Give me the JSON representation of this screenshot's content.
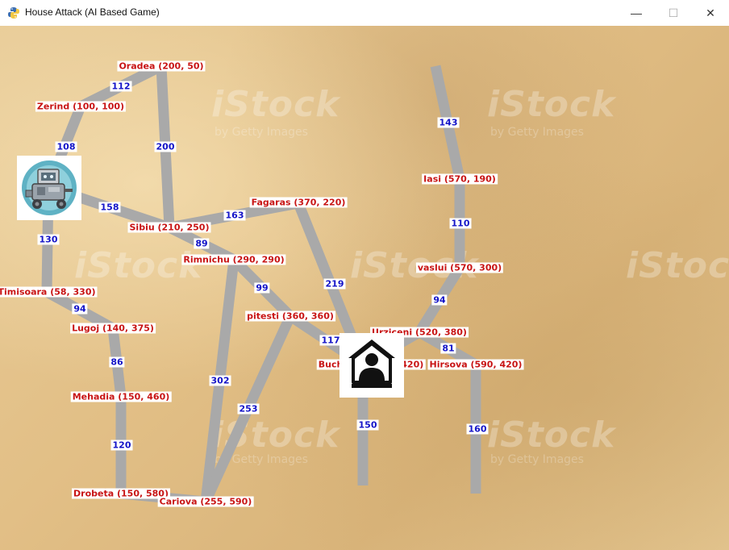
{
  "window": {
    "title": "House Attack (AI Based Game)",
    "minimize_glyph": "—",
    "maximize_glyph": "☐",
    "close_glyph": "✕",
    "app_icon": "python-snake-icon"
  },
  "watermark": {
    "brand": "iStock",
    "sub": "by Getty Images"
  },
  "colors": {
    "road": "#a9a9a9",
    "city_text": "#c81414",
    "distance_text": "#1414c8",
    "sand": "#e2bf86"
  },
  "cities": [
    {
      "id": "oradea",
      "label": "Oradea (200, 50)"
    },
    {
      "id": "zerind",
      "label": "Zerind (100, 100)"
    },
    {
      "id": "sibiu",
      "label": "Sibiu (210, 250)"
    },
    {
      "id": "fagaras",
      "label": "Fagaras (370, 220)"
    },
    {
      "id": "rimnichu",
      "label": "Rimnichu (290, 290)"
    },
    {
      "id": "timisoara",
      "label": "Timisoara (58, 330)"
    },
    {
      "id": "lugoj",
      "label": "Lugoj (140, 375)"
    },
    {
      "id": "pitesti",
      "label": "pitesti (360, 360)"
    },
    {
      "id": "mehadia",
      "label": "Mehadia (150, 460)"
    },
    {
      "id": "drobeta",
      "label": "Drobeta (150, 580)"
    },
    {
      "id": "cariova",
      "label": "Cariova (255, 590)"
    },
    {
      "id": "iasi",
      "label": "Iasi (570, 190)"
    },
    {
      "id": "vaslui",
      "label": "vaslui (570, 300)"
    },
    {
      "id": "urziceni",
      "label": "Urziceni (520, 380)"
    },
    {
      "id": "bucharest",
      "label": "Bucharest (450, 420)"
    },
    {
      "id": "hirsova",
      "label": "Hirsova (590, 420)"
    }
  ],
  "distances": [
    {
      "id": "oradea-zerind",
      "value": "112"
    },
    {
      "id": "oradea-sibiu",
      "value": "200"
    },
    {
      "id": "zerind-arad",
      "value": "108"
    },
    {
      "id": "arad-sibiu",
      "value": "158"
    },
    {
      "id": "arad-timisoara",
      "value": "130"
    },
    {
      "id": "sibiu-fagaras",
      "value": "163"
    },
    {
      "id": "sibiu-rimnichu",
      "value": "89"
    },
    {
      "id": "fagaras-bucharest",
      "value": "219"
    },
    {
      "id": "rimnichu-pitesti",
      "value": "99"
    },
    {
      "id": "rimnichu-cariova",
      "value": "302"
    },
    {
      "id": "pitesti-cariova",
      "value": "253"
    },
    {
      "id": "pitesti-bucharest",
      "value": "117"
    },
    {
      "id": "timisoara-lugoj",
      "value": "94"
    },
    {
      "id": "lugoj-mehadia",
      "value": "86"
    },
    {
      "id": "mehadia-drobeta",
      "value": "120"
    },
    {
      "id": "neamt-iasi",
      "value": "143"
    },
    {
      "id": "iasi-vaslui",
      "value": "110"
    },
    {
      "id": "vaslui-urziceni",
      "value": "94"
    },
    {
      "id": "urziceni-hirsova",
      "value": "81"
    },
    {
      "id": "bucharest-giurgiu",
      "value": "150"
    },
    {
      "id": "hirsova-eforie",
      "value": "160"
    }
  ],
  "sprites": {
    "robot": "robot-attacker-icon",
    "house": "house-target-icon"
  }
}
